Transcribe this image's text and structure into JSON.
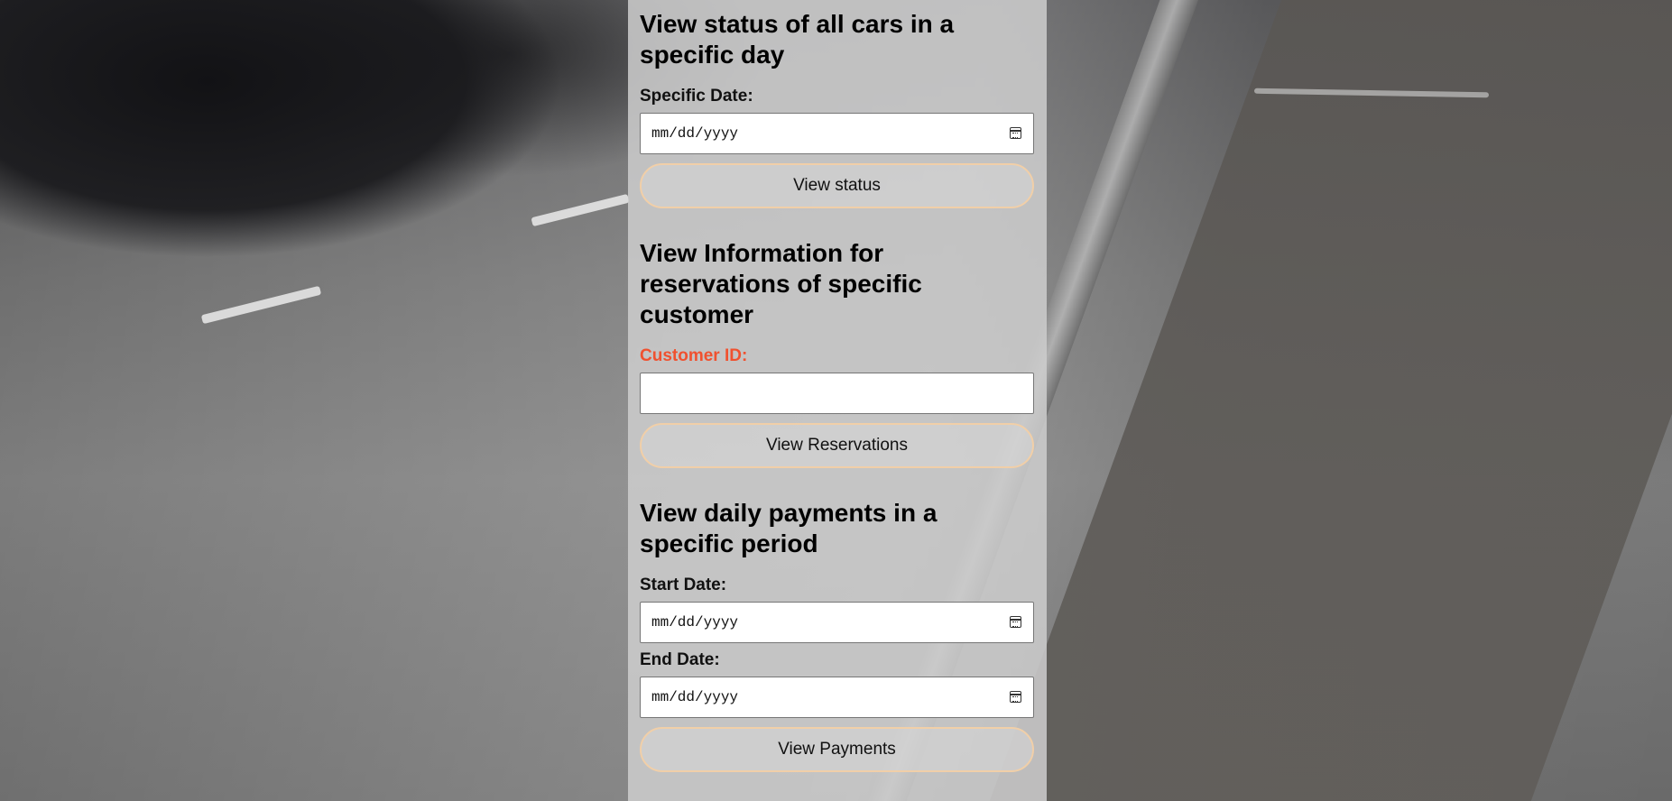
{
  "status_section": {
    "title": "View status of all cars in a specific day",
    "date_label": "Specific Date:",
    "date_value": "mm/dd/yyyy",
    "button_label": "View status"
  },
  "reservations_section": {
    "title": "View Information for reservations of specific customer",
    "customer_label": "Customer ID:",
    "customer_value": "",
    "button_label": "View Reservations"
  },
  "payments_section": {
    "title": "View daily payments in a specific period",
    "start_label": "Start Date:",
    "start_value": "mm/dd/yyyy",
    "end_label": "End Date:",
    "end_value": "mm/dd/yyyy",
    "button_label": "View Payments"
  },
  "colors": {
    "alert_label": "#f0512f",
    "button_border": "#f1cfa8"
  },
  "icons": {
    "date_picker": "calendar-icon"
  }
}
